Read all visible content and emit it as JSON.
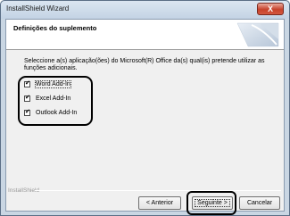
{
  "window": {
    "title": "InstallShield Wizard",
    "close_label": "X"
  },
  "header": {
    "title": "Definições do suplemento"
  },
  "instructions": "Seleccione a(s) aplicação(ões) do Microsoft(R) Office da(s) qual(is) pretende utilizar as funções adicionais.",
  "addins": [
    {
      "label": "Word Add-In",
      "checked": true,
      "check_glyph": "✔"
    },
    {
      "label": "Excel Add-In",
      "checked": true,
      "check_glyph": "✔"
    },
    {
      "label": "Outlook Add-In",
      "checked": true,
      "check_glyph": "✔"
    }
  ],
  "footer": {
    "brand": "InstallShield"
  },
  "buttons": {
    "back": "< Anterior",
    "next": "Seguinte >",
    "cancel": "Cancelar"
  }
}
